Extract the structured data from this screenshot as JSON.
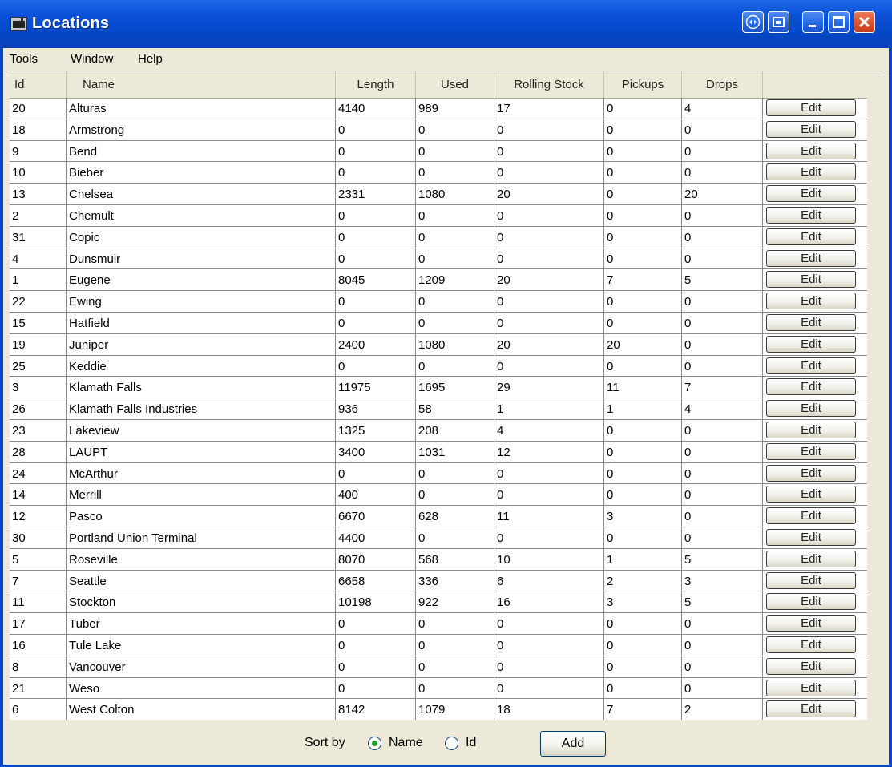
{
  "window": {
    "title": "Locations",
    "icon": "locomotive-icon"
  },
  "title_buttons": [
    "scroll-icon",
    "restore-icon",
    "minimize-icon",
    "maximize-icon",
    "close-icon"
  ],
  "menu": {
    "items": [
      "Tools",
      "Window",
      "Help"
    ]
  },
  "table": {
    "columns": [
      "Id",
      "Name",
      "Length",
      "Used",
      "Rolling Stock",
      "Pickups",
      "Drops",
      ""
    ],
    "rows": [
      [
        "20",
        "Alturas",
        "4140",
        "989",
        "17",
        "0",
        "4",
        "Edit"
      ],
      [
        "18",
        "Armstrong",
        "0",
        "0",
        "0",
        "0",
        "0",
        "Edit"
      ],
      [
        "9",
        "Bend",
        "0",
        "0",
        "0",
        "0",
        "0",
        "Edit"
      ],
      [
        "10",
        "Bieber",
        "0",
        "0",
        "0",
        "0",
        "0",
        "Edit"
      ],
      [
        "13",
        "Chelsea",
        "2331",
        "1080",
        "20",
        "0",
        "20",
        "Edit"
      ],
      [
        "2",
        "Chemult",
        "0",
        "0",
        "0",
        "0",
        "0",
        "Edit"
      ],
      [
        "31",
        "Copic",
        "0",
        "0",
        "0",
        "0",
        "0",
        "Edit"
      ],
      [
        "4",
        "Dunsmuir",
        "0",
        "0",
        "0",
        "0",
        "0",
        "Edit"
      ],
      [
        "1",
        "Eugene",
        "8045",
        "1209",
        "20",
        "7",
        "5",
        "Edit"
      ],
      [
        "22",
        "Ewing",
        "0",
        "0",
        "0",
        "0",
        "0",
        "Edit"
      ],
      [
        "15",
        "Hatfield",
        "0",
        "0",
        "0",
        "0",
        "0",
        "Edit"
      ],
      [
        "19",
        "Juniper",
        "2400",
        "1080",
        "20",
        "20",
        "0",
        "Edit"
      ],
      [
        "25",
        "Keddie",
        "0",
        "0",
        "0",
        "0",
        "0",
        "Edit"
      ],
      [
        "3",
        "Klamath Falls",
        "11975",
        "1695",
        "29",
        "11",
        "7",
        "Edit"
      ],
      [
        "26",
        "Klamath Falls Industries",
        "936",
        "58",
        "1",
        "1",
        "4",
        "Edit"
      ],
      [
        "23",
        "Lakeview",
        "1325",
        "208",
        "4",
        "0",
        "0",
        "Edit"
      ],
      [
        "28",
        "LAUPT",
        "3400",
        "1031",
        "12",
        "0",
        "0",
        "Edit"
      ],
      [
        "24",
        "McArthur",
        "0",
        "0",
        "0",
        "0",
        "0",
        "Edit"
      ],
      [
        "14",
        "Merrill",
        "400",
        "0",
        "0",
        "0",
        "0",
        "Edit"
      ],
      [
        "12",
        "Pasco",
        "6670",
        "628",
        "11",
        "3",
        "0",
        "Edit"
      ],
      [
        "30",
        "Portland Union Terminal",
        "4400",
        "0",
        "0",
        "0",
        "0",
        "Edit"
      ],
      [
        "5",
        "Roseville",
        "8070",
        "568",
        "10",
        "1",
        "5",
        "Edit"
      ],
      [
        "7",
        "Seattle",
        "6658",
        "336",
        "6",
        "2",
        "3",
        "Edit"
      ],
      [
        "11",
        "Stockton",
        "10198",
        "922",
        "16",
        "3",
        "5",
        "Edit"
      ],
      [
        "17",
        "Tuber",
        "0",
        "0",
        "0",
        "0",
        "0",
        "Edit"
      ],
      [
        "16",
        "Tule Lake",
        "0",
        "0",
        "0",
        "0",
        "0",
        "Edit"
      ],
      [
        "8",
        "Vancouver",
        "0",
        "0",
        "0",
        "0",
        "0",
        "Edit"
      ],
      [
        "21",
        "Weso",
        "0",
        "0",
        "0",
        "0",
        "0",
        "Edit"
      ],
      [
        "6",
        "West Colton",
        "8142",
        "1079",
        "18",
        "7",
        "2",
        "Edit"
      ]
    ]
  },
  "footer": {
    "sort_label": "Sort by",
    "sort_options": [
      {
        "label": "Name",
        "selected": true
      },
      {
        "label": "Id",
        "selected": false
      }
    ],
    "add_label": "Add"
  },
  "colors": {
    "titlebar": "#0a52d8",
    "selected_radio": "#21a121",
    "close_button": "#d9512a"
  }
}
